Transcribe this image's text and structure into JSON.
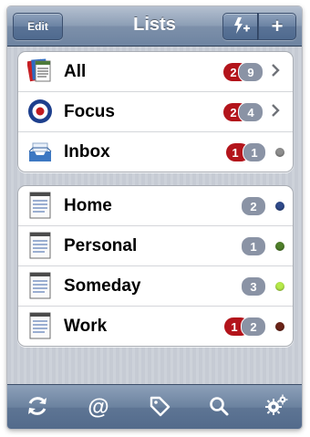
{
  "navbar": {
    "title": "Lists",
    "edit_label": "Edit",
    "add_label": "+",
    "quick_add_icon": "lightning-plus-icon"
  },
  "groups": [
    {
      "rows": [
        {
          "label": "All",
          "icon": "stacked-lists-icon",
          "red_badge": "2",
          "grey_badge": "9",
          "accessory": "chevron"
        },
        {
          "label": "Focus",
          "icon": "target-roundel-icon",
          "red_badge": "2",
          "grey_badge": "4",
          "accessory": "chevron"
        },
        {
          "label": "Inbox",
          "icon": "inbox-tray-icon",
          "red_badge": "1",
          "grey_badge": "1",
          "accessory": "dot",
          "dot_color": "#8e8e8e"
        }
      ]
    },
    {
      "rows": [
        {
          "label": "Home",
          "icon": "list-sheet-icon",
          "grey_badge": "2",
          "accessory": "dot",
          "dot_color": "#2f4a8a"
        },
        {
          "label": "Personal",
          "icon": "list-sheet-icon",
          "grey_badge": "1",
          "accessory": "dot",
          "dot_color": "#4f7f2a"
        },
        {
          "label": "Someday",
          "icon": "list-sheet-icon",
          "grey_badge": "3",
          "accessory": "dot",
          "dot_color": "#b6ea4a"
        },
        {
          "label": "Work",
          "icon": "list-sheet-icon",
          "red_badge": "1",
          "grey_badge": "2",
          "accessory": "dot",
          "dot_color": "#6b2418"
        }
      ]
    }
  ],
  "tabbar": {
    "items": [
      "sync-icon",
      "at-sign-icon",
      "tag-icon",
      "search-icon",
      "settings-gears-icon"
    ]
  },
  "colors": {
    "red_badge": "#b3141b",
    "grey_badge": "#8a93a5",
    "navbar": "#7d90aa"
  }
}
